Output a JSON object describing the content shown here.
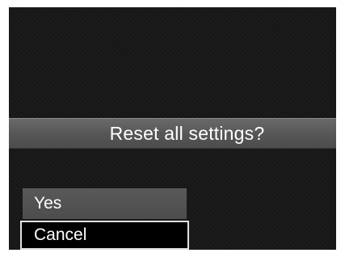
{
  "dialog": {
    "title": "Reset all settings?",
    "options": [
      {
        "label": "Yes",
        "selected": false
      },
      {
        "label": "Cancel",
        "selected": true
      }
    ]
  }
}
